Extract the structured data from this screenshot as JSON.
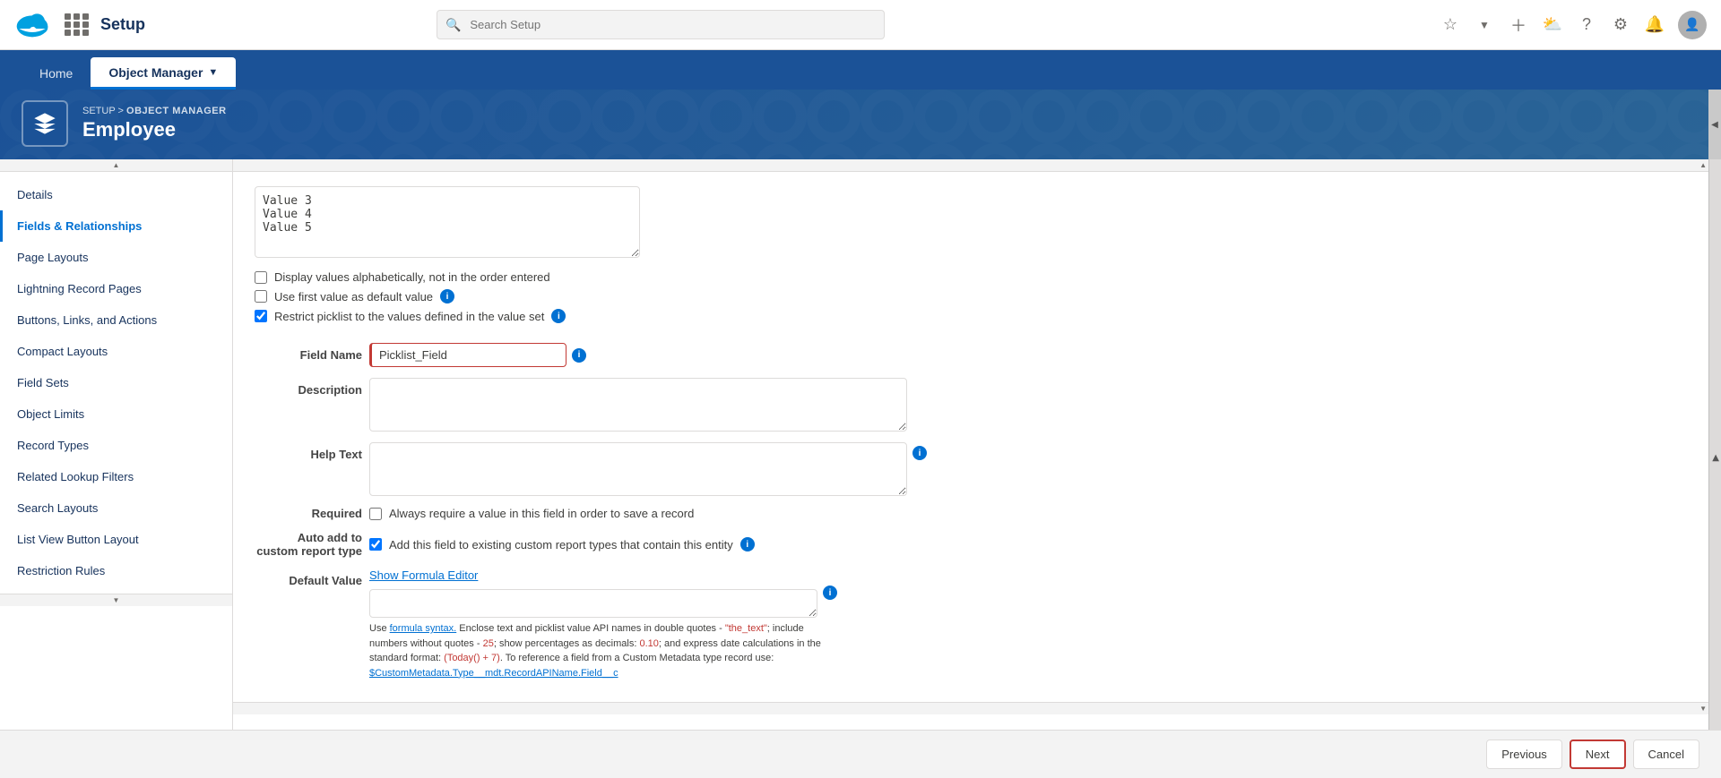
{
  "topNav": {
    "searchPlaceholder": "Search Setup",
    "appName": "Setup"
  },
  "tabBar": {
    "tabs": [
      {
        "id": "home",
        "label": "Home",
        "active": false
      },
      {
        "id": "object-manager",
        "label": "Object Manager",
        "active": true
      }
    ]
  },
  "breadcrumb": {
    "setup": "SETUP",
    "separator": " > ",
    "objectManager": "OBJECT MANAGER",
    "objectName": "Employee"
  },
  "sidebar": {
    "items": [
      {
        "id": "details",
        "label": "Details",
        "active": false
      },
      {
        "id": "fields-relationships",
        "label": "Fields & Relationships",
        "active": true
      },
      {
        "id": "page-layouts",
        "label": "Page Layouts",
        "active": false
      },
      {
        "id": "lightning-record-pages",
        "label": "Lightning Record Pages",
        "active": false
      },
      {
        "id": "buttons-links-actions",
        "label": "Buttons, Links, and Actions",
        "active": false
      },
      {
        "id": "compact-layouts",
        "label": "Compact Layouts",
        "active": false
      },
      {
        "id": "field-sets",
        "label": "Field Sets",
        "active": false
      },
      {
        "id": "object-limits",
        "label": "Object Limits",
        "active": false
      },
      {
        "id": "record-types",
        "label": "Record Types",
        "active": false
      },
      {
        "id": "related-lookup-filters",
        "label": "Related Lookup Filters",
        "active": false
      },
      {
        "id": "search-layouts",
        "label": "Search Layouts",
        "active": false
      },
      {
        "id": "list-view-button-layout",
        "label": "List View Button Layout",
        "active": false
      },
      {
        "id": "restriction-rules",
        "label": "Restriction Rules",
        "active": false
      }
    ]
  },
  "form": {
    "picklistValues": "Value 3\nValue 4\nValue 5",
    "checkboxes": {
      "displayAlphabetically": {
        "label": "Display values alphabetically, not in the order entered",
        "checked": false
      },
      "useFirstValue": {
        "label": "Use first value as default value",
        "checked": false
      },
      "restrictPicklist": {
        "label": "Restrict picklist to the values defined in the value set",
        "checked": true
      }
    },
    "fieldNameLabel": "Field Name",
    "fieldNameValue": "Picklist_Field",
    "fieldNamePlaceholder": "Picklist_Field",
    "descriptionLabel": "Description",
    "helpTextLabel": "Help Text",
    "requiredLabel": "Required",
    "requiredCheckbox": {
      "label": "Always require a value in this field in order to save a record",
      "checked": false
    },
    "autoAddLabel": "Auto add to custom report type",
    "autoAddCheckbox": {
      "label": "Add this field to existing custom report types that contain this entity",
      "checked": true
    },
    "defaultValueLabel": "Default Value",
    "showFormulaEditor": "Show Formula Editor",
    "formulaHint": "Use formula syntax. Enclose text and picklist value API names in double quotes - \"the_text\"; include numbers without quotes - 25; show percentages as decimals: 0.10; and express date calculations in the standard format: (Today() + 7). To reference a field from a Custom Metadata type record use: $CustomMetadata.Type__mdt.RecordAPIName.Field__c"
  },
  "footer": {
    "previousLabel": "Previous",
    "nextLabel": "Next",
    "cancelLabel": "Cancel"
  }
}
